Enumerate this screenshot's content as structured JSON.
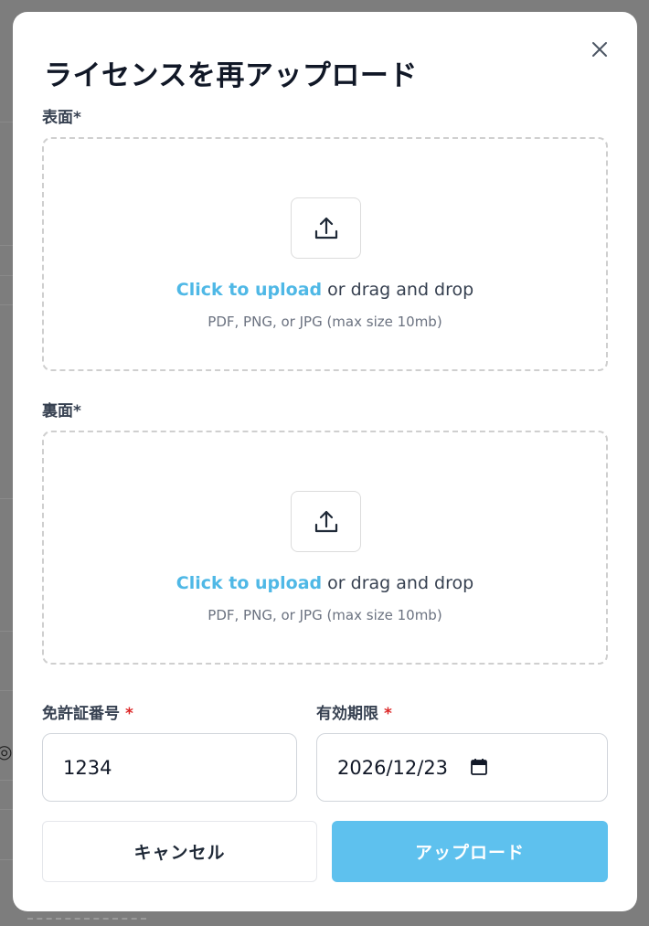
{
  "modal": {
    "title": "ライセンスを再アップロード",
    "close_icon": "close-icon"
  },
  "front": {
    "label": "表面",
    "required_mark": "*",
    "upload_icon": "upload-icon",
    "click_text": "Click to upload",
    "drag_text": " or drag and drop",
    "hint": "PDF, PNG, or JPG (max size 10mb)"
  },
  "back": {
    "label": "裏面",
    "required_mark": "*",
    "upload_icon": "upload-icon",
    "click_text": "Click to upload",
    "drag_text": " or drag and drop",
    "hint": "PDF, PNG, or JPG (max size 10mb)"
  },
  "license_number": {
    "label": "免許証番号",
    "required_mark": "*",
    "value": "1234"
  },
  "expiry": {
    "label": "有効期限",
    "required_mark": "*",
    "value": "2026/12/23",
    "icon": "calendar-icon"
  },
  "actions": {
    "cancel_label": "キャンセル",
    "upload_label": "アップロード"
  },
  "colors": {
    "accent": "#5ec1ee",
    "link": "#4fb8e6",
    "required": "#dc2626",
    "overlay": "#7d7d7d"
  }
}
